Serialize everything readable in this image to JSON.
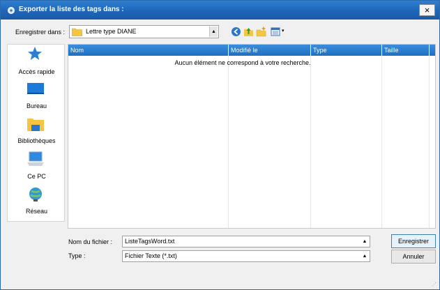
{
  "window": {
    "title": "Exporter la liste des tags dans :",
    "close_glyph": "×"
  },
  "location": {
    "label": "Enregistrer dans :",
    "value": "Lettre type DIANE"
  },
  "toolbar": {
    "icons": [
      "back-icon",
      "up-folder-icon",
      "new-folder-icon",
      "view-menu-icon"
    ]
  },
  "places": [
    {
      "label": "Accès rapide",
      "icon": "star-icon"
    },
    {
      "label": "Bureau",
      "icon": "desktop-icon"
    },
    {
      "label": "Bibliothèques",
      "icon": "libraries-icon"
    },
    {
      "label": "Ce PC",
      "icon": "computer-icon"
    },
    {
      "label": "Réseau",
      "icon": "network-icon"
    }
  ],
  "file_list": {
    "columns": [
      "Nom",
      "Modifié le",
      "Type",
      "Taille"
    ],
    "empty_message": "Aucun élément ne correspond à votre recherche."
  },
  "filename": {
    "label": "Nom du fichier :",
    "value": "ListeTagsWord.txt"
  },
  "filetype": {
    "label": "Type :",
    "value": "Fichier Texte (*.txt)"
  },
  "buttons": {
    "save": "Enregistrer",
    "cancel": "Annuler"
  },
  "colors": {
    "titlebar": "#1f66b8",
    "header": "#2a7fd4"
  }
}
